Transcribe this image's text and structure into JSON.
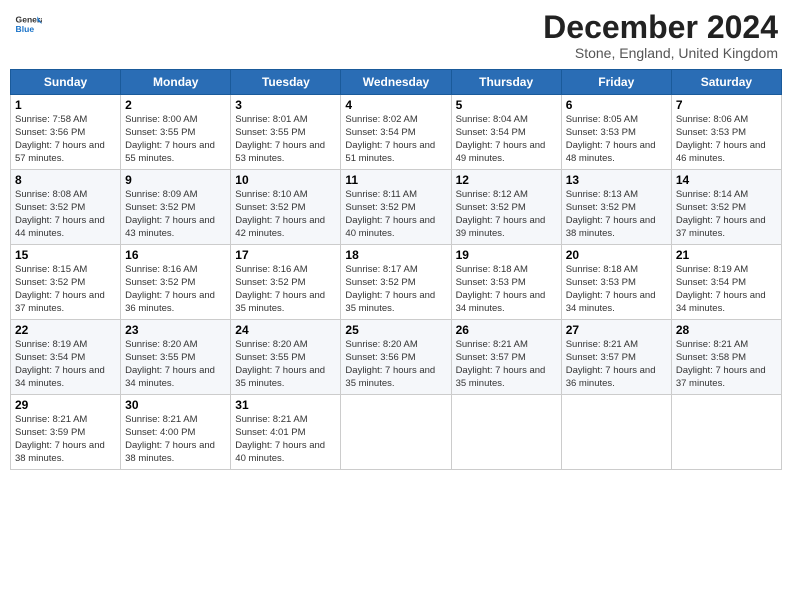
{
  "header": {
    "logo_line1": "General",
    "logo_line2": "Blue",
    "month": "December 2024",
    "location": "Stone, England, United Kingdom"
  },
  "days_of_week": [
    "Sunday",
    "Monday",
    "Tuesday",
    "Wednesday",
    "Thursday",
    "Friday",
    "Saturday"
  ],
  "weeks": [
    [
      {
        "day": 1,
        "sunrise": "7:58 AM",
        "sunset": "3:56 PM",
        "daylight": "7 hours and 57 minutes."
      },
      {
        "day": 2,
        "sunrise": "8:00 AM",
        "sunset": "3:55 PM",
        "daylight": "7 hours and 55 minutes."
      },
      {
        "day": 3,
        "sunrise": "8:01 AM",
        "sunset": "3:55 PM",
        "daylight": "7 hours and 53 minutes."
      },
      {
        "day": 4,
        "sunrise": "8:02 AM",
        "sunset": "3:54 PM",
        "daylight": "7 hours and 51 minutes."
      },
      {
        "day": 5,
        "sunrise": "8:04 AM",
        "sunset": "3:54 PM",
        "daylight": "7 hours and 49 minutes."
      },
      {
        "day": 6,
        "sunrise": "8:05 AM",
        "sunset": "3:53 PM",
        "daylight": "7 hours and 48 minutes."
      },
      {
        "day": 7,
        "sunrise": "8:06 AM",
        "sunset": "3:53 PM",
        "daylight": "7 hours and 46 minutes."
      }
    ],
    [
      {
        "day": 8,
        "sunrise": "8:08 AM",
        "sunset": "3:52 PM",
        "daylight": "7 hours and 44 minutes."
      },
      {
        "day": 9,
        "sunrise": "8:09 AM",
        "sunset": "3:52 PM",
        "daylight": "7 hours and 43 minutes."
      },
      {
        "day": 10,
        "sunrise": "8:10 AM",
        "sunset": "3:52 PM",
        "daylight": "7 hours and 42 minutes."
      },
      {
        "day": 11,
        "sunrise": "8:11 AM",
        "sunset": "3:52 PM",
        "daylight": "7 hours and 40 minutes."
      },
      {
        "day": 12,
        "sunrise": "8:12 AM",
        "sunset": "3:52 PM",
        "daylight": "7 hours and 39 minutes."
      },
      {
        "day": 13,
        "sunrise": "8:13 AM",
        "sunset": "3:52 PM",
        "daylight": "7 hours and 38 minutes."
      },
      {
        "day": 14,
        "sunrise": "8:14 AM",
        "sunset": "3:52 PM",
        "daylight": "7 hours and 37 minutes."
      }
    ],
    [
      {
        "day": 15,
        "sunrise": "8:15 AM",
        "sunset": "3:52 PM",
        "daylight": "7 hours and 37 minutes."
      },
      {
        "day": 16,
        "sunrise": "8:16 AM",
        "sunset": "3:52 PM",
        "daylight": "7 hours and 36 minutes."
      },
      {
        "day": 17,
        "sunrise": "8:16 AM",
        "sunset": "3:52 PM",
        "daylight": "7 hours and 35 minutes."
      },
      {
        "day": 18,
        "sunrise": "8:17 AM",
        "sunset": "3:52 PM",
        "daylight": "7 hours and 35 minutes."
      },
      {
        "day": 19,
        "sunrise": "8:18 AM",
        "sunset": "3:53 PM",
        "daylight": "7 hours and 34 minutes."
      },
      {
        "day": 20,
        "sunrise": "8:18 AM",
        "sunset": "3:53 PM",
        "daylight": "7 hours and 34 minutes."
      },
      {
        "day": 21,
        "sunrise": "8:19 AM",
        "sunset": "3:54 PM",
        "daylight": "7 hours and 34 minutes."
      }
    ],
    [
      {
        "day": 22,
        "sunrise": "8:19 AM",
        "sunset": "3:54 PM",
        "daylight": "7 hours and 34 minutes."
      },
      {
        "day": 23,
        "sunrise": "8:20 AM",
        "sunset": "3:55 PM",
        "daylight": "7 hours and 34 minutes."
      },
      {
        "day": 24,
        "sunrise": "8:20 AM",
        "sunset": "3:55 PM",
        "daylight": "7 hours and 35 minutes."
      },
      {
        "day": 25,
        "sunrise": "8:20 AM",
        "sunset": "3:56 PM",
        "daylight": "7 hours and 35 minutes."
      },
      {
        "day": 26,
        "sunrise": "8:21 AM",
        "sunset": "3:57 PM",
        "daylight": "7 hours and 35 minutes."
      },
      {
        "day": 27,
        "sunrise": "8:21 AM",
        "sunset": "3:57 PM",
        "daylight": "7 hours and 36 minutes."
      },
      {
        "day": 28,
        "sunrise": "8:21 AM",
        "sunset": "3:58 PM",
        "daylight": "7 hours and 37 minutes."
      }
    ],
    [
      {
        "day": 29,
        "sunrise": "8:21 AM",
        "sunset": "3:59 PM",
        "daylight": "7 hours and 38 minutes."
      },
      {
        "day": 30,
        "sunrise": "8:21 AM",
        "sunset": "4:00 PM",
        "daylight": "7 hours and 38 minutes."
      },
      {
        "day": 31,
        "sunrise": "8:21 AM",
        "sunset": "4:01 PM",
        "daylight": "7 hours and 40 minutes."
      },
      null,
      null,
      null,
      null
    ]
  ]
}
